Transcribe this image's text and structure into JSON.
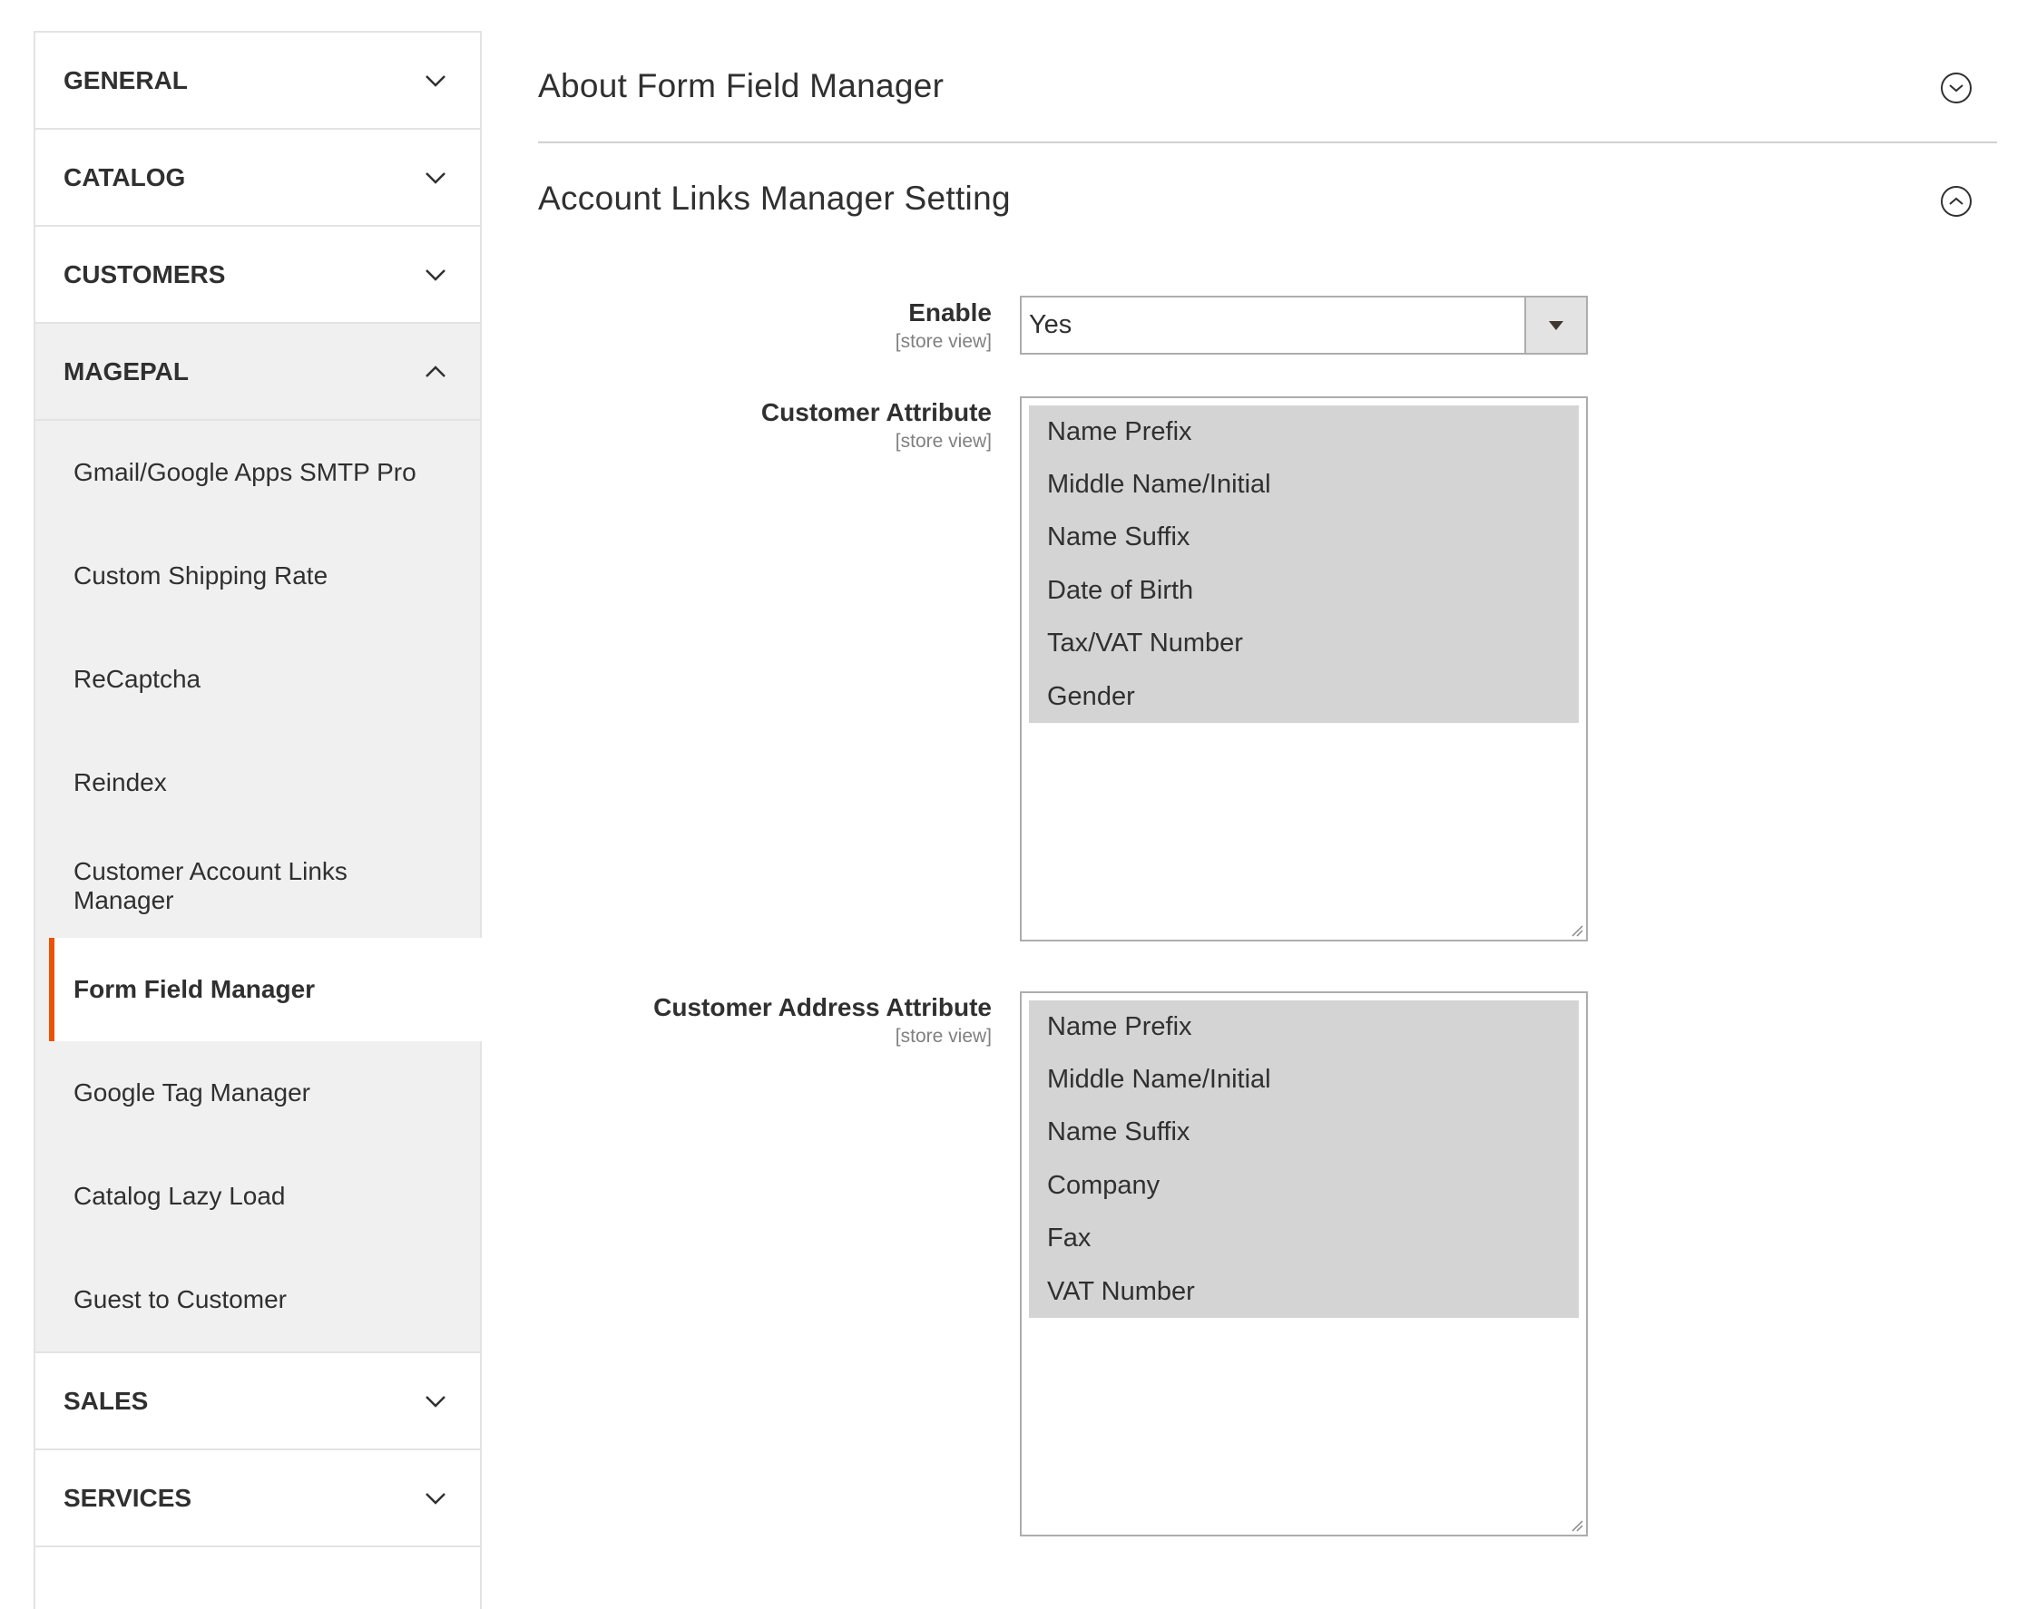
{
  "sidebar": {
    "sections_top": [
      {
        "label": "GENERAL"
      },
      {
        "label": "CATALOG"
      },
      {
        "label": "CUSTOMERS"
      }
    ],
    "open_section": {
      "label": "MAGEPAL",
      "items": [
        {
          "label": "Gmail/Google Apps SMTP Pro"
        },
        {
          "label": "Custom Shipping Rate"
        },
        {
          "label": "ReCaptcha"
        },
        {
          "label": "Reindex"
        },
        {
          "label": "Customer Account Links Manager"
        },
        {
          "label": "Form Field Manager",
          "active": true
        },
        {
          "label": "Google Tag Manager"
        },
        {
          "label": "Catalog Lazy Load"
        },
        {
          "label": "Guest to Customer"
        }
      ]
    },
    "sections_bottom": [
      {
        "label": "SALES"
      },
      {
        "label": "SERVICES"
      }
    ]
  },
  "main": {
    "about_title": "About Form Field Manager",
    "settings_title": "Account Links Manager Setting",
    "enable": {
      "label": "Enable",
      "scope": "[store view]",
      "value": "Yes"
    },
    "customer_attribute": {
      "label": "Customer Attribute",
      "scope": "[store view]",
      "options": [
        "Name Prefix",
        "Middle Name/Initial",
        "Name Suffix",
        "Date of Birth",
        "Tax/VAT Number",
        "Gender"
      ]
    },
    "customer_address_attribute": {
      "label": "Customer Address Attribute",
      "scope": "[store view]",
      "options": [
        "Name Prefix",
        "Middle Name/Initial",
        "Name Suffix",
        "Company",
        "Fax",
        "VAT Number"
      ]
    }
  },
  "colors": {
    "active_accent": "#eb5202",
    "selected_option_bg": "#d4d4d4",
    "sidebar_open_bg": "#f0f0f0"
  }
}
